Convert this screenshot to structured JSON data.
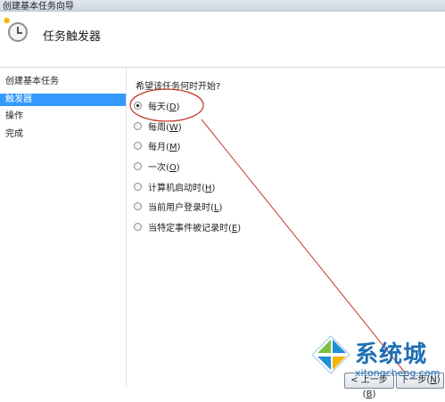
{
  "window": {
    "title": "创建基本任务向导"
  },
  "header": {
    "title": "任务触发器",
    "icon": "clock-icon"
  },
  "sidebar": {
    "items": [
      {
        "label": "创建基本任务",
        "active": false
      },
      {
        "label": "触发器",
        "active": true
      },
      {
        "label": "操作",
        "active": false
      },
      {
        "label": "完成",
        "active": false
      }
    ]
  },
  "main": {
    "question": "希望该任务何时开始?",
    "options": [
      {
        "label": "每天(",
        "key": "D",
        "suffix": ")",
        "checked": true
      },
      {
        "label": "每周(",
        "key": "W",
        "suffix": ")",
        "checked": false
      },
      {
        "label": "每月(",
        "key": "M",
        "suffix": ")",
        "checked": false
      },
      {
        "label": "一次(",
        "key": "O",
        "suffix": ")",
        "checked": false
      },
      {
        "label": "计算机启动时(",
        "key": "H",
        "suffix": ")",
        "checked": false
      },
      {
        "label": "当前用户登录时(",
        "key": "L",
        "suffix": ")",
        "checked": false
      },
      {
        "label": "当特定事件被记录时(",
        "key": "E",
        "suffix": ")",
        "checked": false
      }
    ]
  },
  "footer": {
    "back_label": "< 上一步(",
    "back_key": "B",
    "next_label": "下一步(",
    "next_key": "N"
  },
  "watermark": {
    "brand": "系统城",
    "url": "xitongcheng.com"
  },
  "colors": {
    "accent": "#3399ff",
    "annotation": "#c0392b"
  }
}
